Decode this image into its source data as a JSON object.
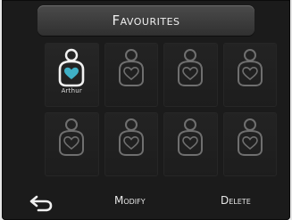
{
  "header": {
    "title": "Favourites"
  },
  "favourites": [
    {
      "label": "Arthur",
      "active": true
    },
    {
      "label": "",
      "active": false
    },
    {
      "label": "",
      "active": false
    },
    {
      "label": "",
      "active": false
    },
    {
      "label": "",
      "active": false
    },
    {
      "label": "",
      "active": false
    },
    {
      "label": "",
      "active": false
    },
    {
      "label": "",
      "active": false
    }
  ],
  "footer": {
    "back_icon": "back-arrow-icon",
    "modify_label": "Modify",
    "delete_label": "Delete"
  },
  "colors": {
    "accent_heart": "#3fb0c6",
    "active_icon": "#f2f2f2",
    "inactive_icon": "#6f6f6f"
  }
}
